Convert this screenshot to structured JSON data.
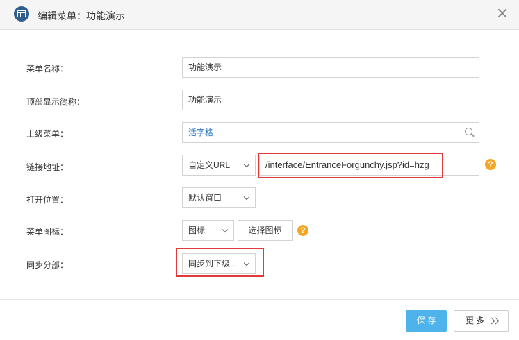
{
  "dialog": {
    "title": "编辑菜单：功能演示",
    "icons": {
      "app": "window-icon",
      "close": "close-icon"
    }
  },
  "form": {
    "menu_name": {
      "label": "菜单名称：",
      "value": "功能演示"
    },
    "top_display_short_name": {
      "label": "顶部显示简称：",
      "value": "功能演示"
    },
    "parent_menu": {
      "label": "上级菜单：",
      "value": "活字格",
      "icon": "search-icon"
    },
    "link_address": {
      "label": "链接地址：",
      "type": "自定义URL",
      "url": "/interface/EntranceForgunchy.jsp?id=hzg",
      "help": "?"
    },
    "open_position": {
      "label": "打开位置：",
      "value": "默认窗口"
    },
    "menu_icon": {
      "label": "菜单图标：",
      "value": "图标",
      "choose_label": "选择图标",
      "help": "?"
    },
    "sync_branch": {
      "label": "同步分部：",
      "value": "同步到下级..."
    }
  },
  "footer": {
    "save_label": "保 存",
    "more_label": "更 多"
  },
  "colors": {
    "accent": "#4db3ea",
    "highlight": "#e03a3a",
    "help": "#f5a623",
    "link": "#2f78c4"
  }
}
